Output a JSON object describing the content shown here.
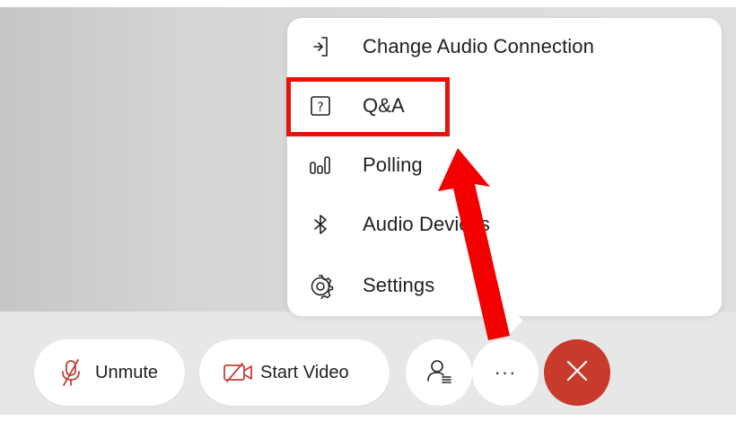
{
  "menu": {
    "items": [
      {
        "label": "Change Audio Connection",
        "icon": "audio-connection-icon"
      },
      {
        "label": "Q&A",
        "icon": "question-icon"
      },
      {
        "label": "Polling",
        "icon": "polling-icon"
      },
      {
        "label": "Audio Devices",
        "icon": "bluetooth-icon"
      },
      {
        "label": "Settings",
        "icon": "gear-icon"
      }
    ]
  },
  "toolbar": {
    "unmute_label": "Unmute",
    "start_video_label": "Start Video",
    "participants_icon": "participants-icon",
    "more_glyph": "···",
    "end_icon": "close-icon"
  },
  "colors": {
    "highlight": "#e8120c",
    "arrow": "#f20000",
    "end_call": "#c73a2c",
    "muted_icon": "#c2423a"
  }
}
